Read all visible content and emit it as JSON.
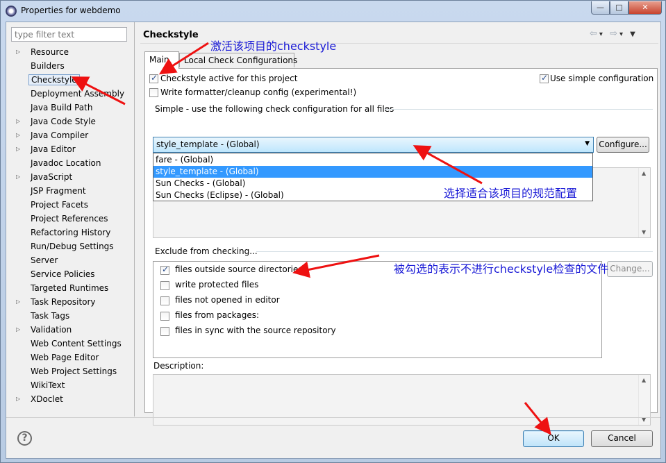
{
  "window": {
    "title": "Properties for webdemo",
    "buttons": {
      "minimize": "—",
      "maximize": "□",
      "close": "✕"
    }
  },
  "filter": {
    "placeholder": "type filter text"
  },
  "tree": [
    {
      "label": "Resource",
      "expandable": true
    },
    {
      "label": "Builders",
      "expandable": false
    },
    {
      "label": "Checkstyle",
      "expandable": false,
      "selected": true
    },
    {
      "label": "Deployment Assembly",
      "expandable": false
    },
    {
      "label": "Java Build Path",
      "expandable": false
    },
    {
      "label": "Java Code Style",
      "expandable": true
    },
    {
      "label": "Java Compiler",
      "expandable": true
    },
    {
      "label": "Java Editor",
      "expandable": true
    },
    {
      "label": "Javadoc Location",
      "expandable": false
    },
    {
      "label": "JavaScript",
      "expandable": true
    },
    {
      "label": "JSP Fragment",
      "expandable": false
    },
    {
      "label": "Project Facets",
      "expandable": false
    },
    {
      "label": "Project References",
      "expandable": false
    },
    {
      "label": "Refactoring History",
      "expandable": false
    },
    {
      "label": "Run/Debug Settings",
      "expandable": false
    },
    {
      "label": "Server",
      "expandable": false
    },
    {
      "label": "Service Policies",
      "expandable": false
    },
    {
      "label": "Targeted Runtimes",
      "expandable": false
    },
    {
      "label": "Task Repository",
      "expandable": true
    },
    {
      "label": "Task Tags",
      "expandable": false
    },
    {
      "label": "Validation",
      "expandable": true
    },
    {
      "label": "Web Content Settings",
      "expandable": false
    },
    {
      "label": "Web Page Editor",
      "expandable": false
    },
    {
      "label": "Web Project Settings",
      "expandable": false
    },
    {
      "label": "WikiText",
      "expandable": false
    },
    {
      "label": "XDoclet",
      "expandable": true
    }
  ],
  "page": {
    "title": "Checkstyle",
    "tabs": [
      {
        "label": "Main"
      },
      {
        "label": "Local Check Configurations"
      }
    ],
    "checkstyle_active": {
      "label": "Checkstyle active for this project",
      "checked": true
    },
    "write_formatter": {
      "label": "Write formatter/cleanup config (experimental!)",
      "checked": false
    },
    "use_simple": {
      "label": "Use simple configuration",
      "checked": true
    },
    "simple_group": "Simple - use the following check configuration for all files",
    "combo_value": "style_template  - (Global)",
    "configure_button": "Configure...",
    "options": [
      {
        "label": "fare  - (Global)",
        "selected": false
      },
      {
        "label": "style_template  - (Global)",
        "selected": true
      },
      {
        "label": "Sun Checks  - (Global)",
        "selected": false
      },
      {
        "label": "Sun Checks (Eclipse)  - (Global)",
        "selected": false
      }
    ],
    "exclude_group": "Exclude from checking...",
    "exclude_items": [
      {
        "label": "files outside source directories",
        "checked": true
      },
      {
        "label": "write protected files",
        "checked": false
      },
      {
        "label": "files not opened in editor",
        "checked": false
      },
      {
        "label": "files from packages:",
        "checked": false
      },
      {
        "label": "files in sync with the source repository",
        "checked": false
      }
    ],
    "change_button": "Change...",
    "description_label": "Description:"
  },
  "footer": {
    "help": "?",
    "ok": "OK",
    "cancel": "Cancel"
  },
  "annotations": {
    "activate": "激活该项目的checkstyle",
    "choose_config": "选择适合该项目的规范配置",
    "excluded": "被勾选的表示不进行checkstyle检查的文件"
  },
  "colors": {
    "annotation": "#1a1ad6",
    "arrow": "#ee1111",
    "selection": "#3399ff"
  }
}
